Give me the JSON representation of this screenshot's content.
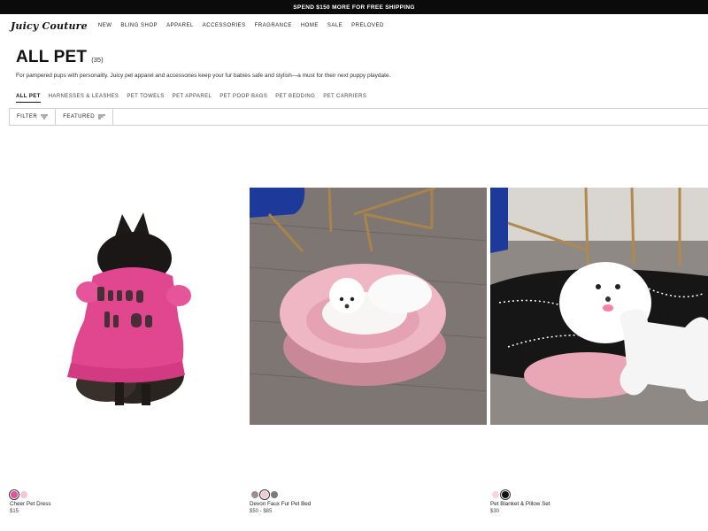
{
  "promo": {
    "text": "SPEND $150 MORE FOR FREE SHIPPING"
  },
  "header": {
    "logo": "Juicy Couture",
    "nav": [
      "NEW",
      "BLING SHOP",
      "APPAREL",
      "ACCESSORIES",
      "FRAGRANCE",
      "HOME",
      "SALE",
      "PRELOVED"
    ]
  },
  "page": {
    "title": "ALL PET",
    "count": "(35)",
    "description": "For pampered pups with personality. Juicy pet apparel and accessories keep your fur babies safe and stylish—a must for their next puppy playdate."
  },
  "tabs": [
    "ALL PET",
    "HARNESSES & LEASHES",
    "PET TOWELS",
    "PET APPAREL",
    "PET POOP BAGS",
    "PET BEDDING",
    "PET CARRIERS"
  ],
  "filters": {
    "filter_label": "FILTER",
    "sort_label": "FEATURED"
  },
  "products": [
    {
      "name": "Cheer Pet Dress",
      "price": "$15",
      "swatches": [
        "#e0529c",
        "#f2c6d2"
      ]
    },
    {
      "name": "Devon Faux Fur Pet Bed",
      "price": "$50 - $85",
      "swatches": [
        "#9e8f8f",
        "#f4c9d4",
        "#7b7b7b"
      ]
    },
    {
      "name": "Pet Blanket & Pillow Set",
      "price": "$30",
      "swatches": [
        "#f8d5dd",
        "#111111"
      ]
    }
  ]
}
